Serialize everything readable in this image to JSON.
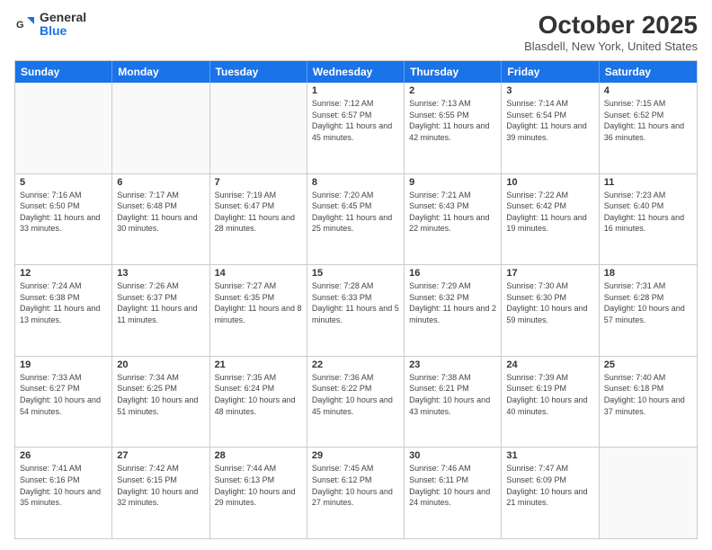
{
  "header": {
    "logo_general": "General",
    "logo_blue": "Blue",
    "title": "October 2025",
    "subtitle": "Blasdell, New York, United States"
  },
  "weekdays": [
    "Sunday",
    "Monday",
    "Tuesday",
    "Wednesday",
    "Thursday",
    "Friday",
    "Saturday"
  ],
  "rows": [
    [
      {
        "num": "",
        "sunrise": "",
        "sunset": "",
        "daylight": ""
      },
      {
        "num": "",
        "sunrise": "",
        "sunset": "",
        "daylight": ""
      },
      {
        "num": "",
        "sunrise": "",
        "sunset": "",
        "daylight": ""
      },
      {
        "num": "1",
        "sunrise": "Sunrise: 7:12 AM",
        "sunset": "Sunset: 6:57 PM",
        "daylight": "Daylight: 11 hours and 45 minutes."
      },
      {
        "num": "2",
        "sunrise": "Sunrise: 7:13 AM",
        "sunset": "Sunset: 6:55 PM",
        "daylight": "Daylight: 11 hours and 42 minutes."
      },
      {
        "num": "3",
        "sunrise": "Sunrise: 7:14 AM",
        "sunset": "Sunset: 6:54 PM",
        "daylight": "Daylight: 11 hours and 39 minutes."
      },
      {
        "num": "4",
        "sunrise": "Sunrise: 7:15 AM",
        "sunset": "Sunset: 6:52 PM",
        "daylight": "Daylight: 11 hours and 36 minutes."
      }
    ],
    [
      {
        "num": "5",
        "sunrise": "Sunrise: 7:16 AM",
        "sunset": "Sunset: 6:50 PM",
        "daylight": "Daylight: 11 hours and 33 minutes."
      },
      {
        "num": "6",
        "sunrise": "Sunrise: 7:17 AM",
        "sunset": "Sunset: 6:48 PM",
        "daylight": "Daylight: 11 hours and 30 minutes."
      },
      {
        "num": "7",
        "sunrise": "Sunrise: 7:19 AM",
        "sunset": "Sunset: 6:47 PM",
        "daylight": "Daylight: 11 hours and 28 minutes."
      },
      {
        "num": "8",
        "sunrise": "Sunrise: 7:20 AM",
        "sunset": "Sunset: 6:45 PM",
        "daylight": "Daylight: 11 hours and 25 minutes."
      },
      {
        "num": "9",
        "sunrise": "Sunrise: 7:21 AM",
        "sunset": "Sunset: 6:43 PM",
        "daylight": "Daylight: 11 hours and 22 minutes."
      },
      {
        "num": "10",
        "sunrise": "Sunrise: 7:22 AM",
        "sunset": "Sunset: 6:42 PM",
        "daylight": "Daylight: 11 hours and 19 minutes."
      },
      {
        "num": "11",
        "sunrise": "Sunrise: 7:23 AM",
        "sunset": "Sunset: 6:40 PM",
        "daylight": "Daylight: 11 hours and 16 minutes."
      }
    ],
    [
      {
        "num": "12",
        "sunrise": "Sunrise: 7:24 AM",
        "sunset": "Sunset: 6:38 PM",
        "daylight": "Daylight: 11 hours and 13 minutes."
      },
      {
        "num": "13",
        "sunrise": "Sunrise: 7:26 AM",
        "sunset": "Sunset: 6:37 PM",
        "daylight": "Daylight: 11 hours and 11 minutes."
      },
      {
        "num": "14",
        "sunrise": "Sunrise: 7:27 AM",
        "sunset": "Sunset: 6:35 PM",
        "daylight": "Daylight: 11 hours and 8 minutes."
      },
      {
        "num": "15",
        "sunrise": "Sunrise: 7:28 AM",
        "sunset": "Sunset: 6:33 PM",
        "daylight": "Daylight: 11 hours and 5 minutes."
      },
      {
        "num": "16",
        "sunrise": "Sunrise: 7:29 AM",
        "sunset": "Sunset: 6:32 PM",
        "daylight": "Daylight: 11 hours and 2 minutes."
      },
      {
        "num": "17",
        "sunrise": "Sunrise: 7:30 AM",
        "sunset": "Sunset: 6:30 PM",
        "daylight": "Daylight: 10 hours and 59 minutes."
      },
      {
        "num": "18",
        "sunrise": "Sunrise: 7:31 AM",
        "sunset": "Sunset: 6:28 PM",
        "daylight": "Daylight: 10 hours and 57 minutes."
      }
    ],
    [
      {
        "num": "19",
        "sunrise": "Sunrise: 7:33 AM",
        "sunset": "Sunset: 6:27 PM",
        "daylight": "Daylight: 10 hours and 54 minutes."
      },
      {
        "num": "20",
        "sunrise": "Sunrise: 7:34 AM",
        "sunset": "Sunset: 6:25 PM",
        "daylight": "Daylight: 10 hours and 51 minutes."
      },
      {
        "num": "21",
        "sunrise": "Sunrise: 7:35 AM",
        "sunset": "Sunset: 6:24 PM",
        "daylight": "Daylight: 10 hours and 48 minutes."
      },
      {
        "num": "22",
        "sunrise": "Sunrise: 7:36 AM",
        "sunset": "Sunset: 6:22 PM",
        "daylight": "Daylight: 10 hours and 45 minutes."
      },
      {
        "num": "23",
        "sunrise": "Sunrise: 7:38 AM",
        "sunset": "Sunset: 6:21 PM",
        "daylight": "Daylight: 10 hours and 43 minutes."
      },
      {
        "num": "24",
        "sunrise": "Sunrise: 7:39 AM",
        "sunset": "Sunset: 6:19 PM",
        "daylight": "Daylight: 10 hours and 40 minutes."
      },
      {
        "num": "25",
        "sunrise": "Sunrise: 7:40 AM",
        "sunset": "Sunset: 6:18 PM",
        "daylight": "Daylight: 10 hours and 37 minutes."
      }
    ],
    [
      {
        "num": "26",
        "sunrise": "Sunrise: 7:41 AM",
        "sunset": "Sunset: 6:16 PM",
        "daylight": "Daylight: 10 hours and 35 minutes."
      },
      {
        "num": "27",
        "sunrise": "Sunrise: 7:42 AM",
        "sunset": "Sunset: 6:15 PM",
        "daylight": "Daylight: 10 hours and 32 minutes."
      },
      {
        "num": "28",
        "sunrise": "Sunrise: 7:44 AM",
        "sunset": "Sunset: 6:13 PM",
        "daylight": "Daylight: 10 hours and 29 minutes."
      },
      {
        "num": "29",
        "sunrise": "Sunrise: 7:45 AM",
        "sunset": "Sunset: 6:12 PM",
        "daylight": "Daylight: 10 hours and 27 minutes."
      },
      {
        "num": "30",
        "sunrise": "Sunrise: 7:46 AM",
        "sunset": "Sunset: 6:11 PM",
        "daylight": "Daylight: 10 hours and 24 minutes."
      },
      {
        "num": "31",
        "sunrise": "Sunrise: 7:47 AM",
        "sunset": "Sunset: 6:09 PM",
        "daylight": "Daylight: 10 hours and 21 minutes."
      },
      {
        "num": "",
        "sunrise": "",
        "sunset": "",
        "daylight": ""
      }
    ]
  ]
}
